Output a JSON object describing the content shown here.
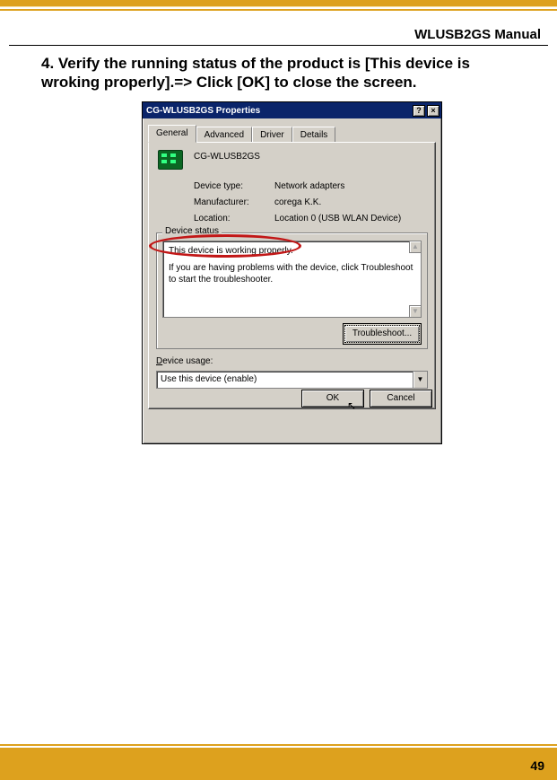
{
  "header": {
    "manual_title": "WLUSB2GS Manual"
  },
  "instruction": {
    "text": "4. Verify the running status of the product is [This device is wroking properly].=> Click [OK] to close the screen."
  },
  "dialog": {
    "title": "CG-WLUSB2GS Properties",
    "help_button": "?",
    "close_button": "×",
    "tabs": {
      "general": "General",
      "advanced": "Advanced",
      "driver": "Driver",
      "details": "Details"
    },
    "device_name": "CG-WLUSB2GS",
    "fields": {
      "device_type_label": "Device type:",
      "device_type_value": "Network adapters",
      "manufacturer_label": "Manufacturer:",
      "manufacturer_value": "corega K.K.",
      "location_label": "Location:",
      "location_value": "Location 0 (USB WLAN Device)"
    },
    "device_status_caption": "Device status",
    "device_status_line1": "This device is working properly.",
    "device_status_line2": "If you are having problems with the device, click Troubleshoot to start the troubleshooter.",
    "troubleshoot_button": "Troubleshoot...",
    "device_usage_label_pre": "",
    "device_usage_label_underline": "D",
    "device_usage_label_post": "evice usage:",
    "device_usage_value": "Use this device (enable)",
    "ok_button": "OK",
    "cancel_button": "Cancel"
  },
  "page_number": "49"
}
